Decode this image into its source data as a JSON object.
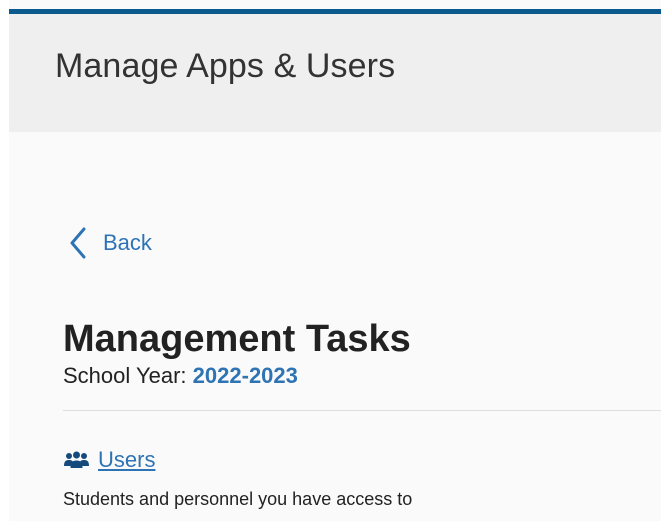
{
  "header": {
    "title": "Manage Apps & Users"
  },
  "navigation": {
    "back_label": "Back",
    "back_icon": "chevron-left-icon"
  },
  "management": {
    "title": "Management Tasks",
    "school_year_label": "School Year:",
    "school_year_value": "2022-2023"
  },
  "users_task": {
    "icon": "users-icon",
    "label": "Users",
    "description": "Students and personnel you have access to"
  },
  "colors": {
    "accent_blue": "#2e74b5",
    "top_bar": "#0b5a8e",
    "header_background": "#efefef",
    "page_background": "#fafafa"
  }
}
